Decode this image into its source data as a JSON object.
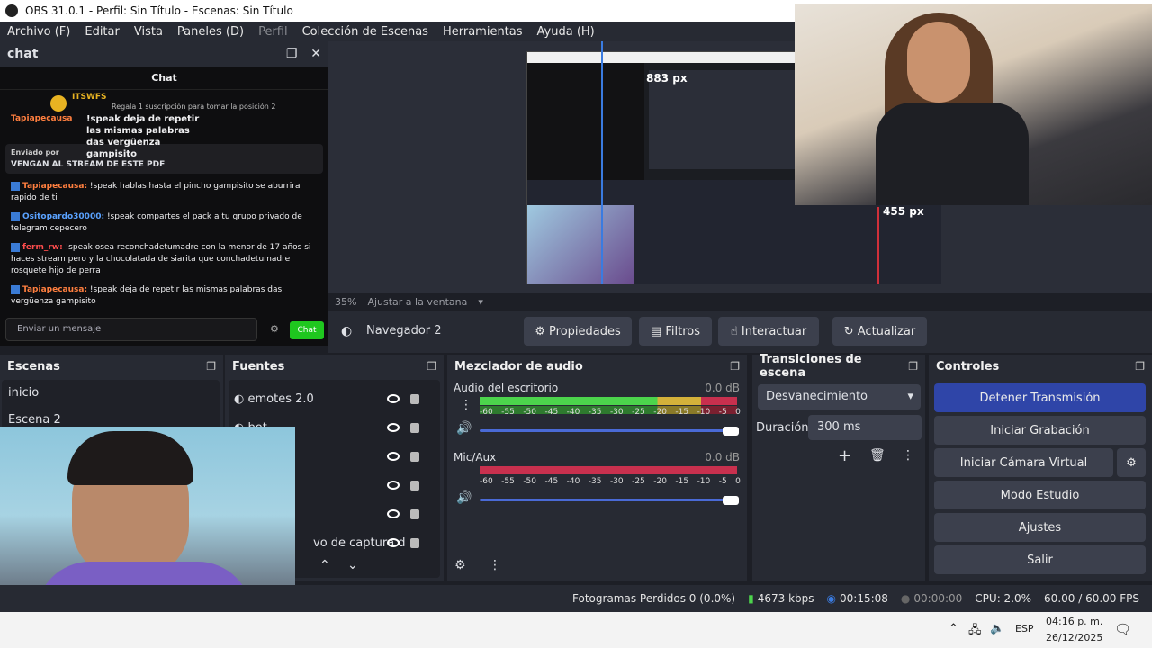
{
  "title": "OBS 31.0.1 - Perfil: Sin Título - Escenas: Sin Título",
  "menu": [
    "Archivo (F)",
    "Editar",
    "Vista",
    "Paneles (D)",
    "Perfil",
    "Colección de Escenas",
    "Herramientas",
    "Ayuda (H)"
  ],
  "chat_dock": {
    "title": "chat",
    "inner_title": "Chat",
    "sub_gift": "Regala 1 suscripción para tomar la posición 2",
    "top_user": "ITSWFS",
    "pinned_user": "Tapiapecausa",
    "pinned_text": "!speak deja de repetir las mismas palabras das vergüenza gampisito",
    "sent_by": "Enviado por",
    "sent_text": "VENGAN AL STREAM DE ESTE PDF",
    "messages": [
      {
        "user": "Tapiapecausa:",
        "text": "!speak hablas hasta el pincho gampisito se aburrira rapido de ti",
        "color": "o"
      },
      {
        "user": "Ositopardo30000:",
        "text": "!speak compartes el pack a tu grupo privado de telegram cepecero",
        "color": "b"
      },
      {
        "user": "ferm_rw:",
        "text": "!speak osea reconchadetumadre con la menor de 17 años si haces stream pero y la chocolatada de siarita que conchadetumadre rosquete hijo de perra",
        "color": "r"
      },
      {
        "user": "Tapiapecausa:",
        "text": "!speak deja de repetir las mismas palabras das vergüenza gampisito",
        "color": "o"
      }
    ],
    "input_placeholder": "Enviar un mensaje",
    "chat_button": "Chat"
  },
  "preview": {
    "measure_1": "883 px",
    "measure_2": "455 px",
    "zoom": "35%",
    "fit_label": "Ajustar a la ventana"
  },
  "source_toolbar": {
    "source_name": "Navegador 2",
    "buttons": [
      "Propiedades",
      "Filtros",
      "Interactuar",
      "Actualizar"
    ]
  },
  "scenes": {
    "title": "Escenas",
    "items": [
      "inicio",
      "Escena 2"
    ]
  },
  "sources": {
    "title": "Fuentes",
    "items": [
      "emotes 2.0",
      "bot",
      "",
      "",
      "",
      "vo de captura d"
    ]
  },
  "mixer": {
    "title": "Mezclador de audio",
    "channels": [
      {
        "name": "Audio del escritorio",
        "db": "0.0 dB"
      },
      {
        "name": "Mic/Aux",
        "db": "0.0 dB"
      }
    ],
    "ticks": [
      "-60",
      "-55",
      "-50",
      "-45",
      "-40",
      "-35",
      "-30",
      "-25",
      "-20",
      "-15",
      "-10",
      "-5",
      "0"
    ]
  },
  "transitions": {
    "title": "Transiciones de escena",
    "selected": "Desvanecimiento",
    "duration_label": "Duración",
    "duration_value": "300 ms"
  },
  "controls": {
    "title": "Controles",
    "buttons": [
      "Detener Transmisión",
      "Iniciar Grabación",
      "Iniciar Cámara Virtual",
      "Modo Estudio",
      "Ajustes",
      "Salir"
    ]
  },
  "status": {
    "dropped": "Fotogramas Perdidos 0 (0.0%)",
    "bitrate": "4673 kbps",
    "stream_time": "00:15:08",
    "rec_time": "00:00:00",
    "cpu": "CPU: 2.0%",
    "fps": "60.00 / 60.00 FPS"
  },
  "taskbar": {
    "lang": "ESP",
    "time": "04:16 p. m.",
    "date": "26/12/2025"
  },
  "colors": {
    "accent_blue": "#2f45a8",
    "meter_green": "#4cd44c",
    "meter_yellow": "#d4b13a",
    "meter_red": "#c8304e",
    "twitch_green": "#1fc71f"
  }
}
